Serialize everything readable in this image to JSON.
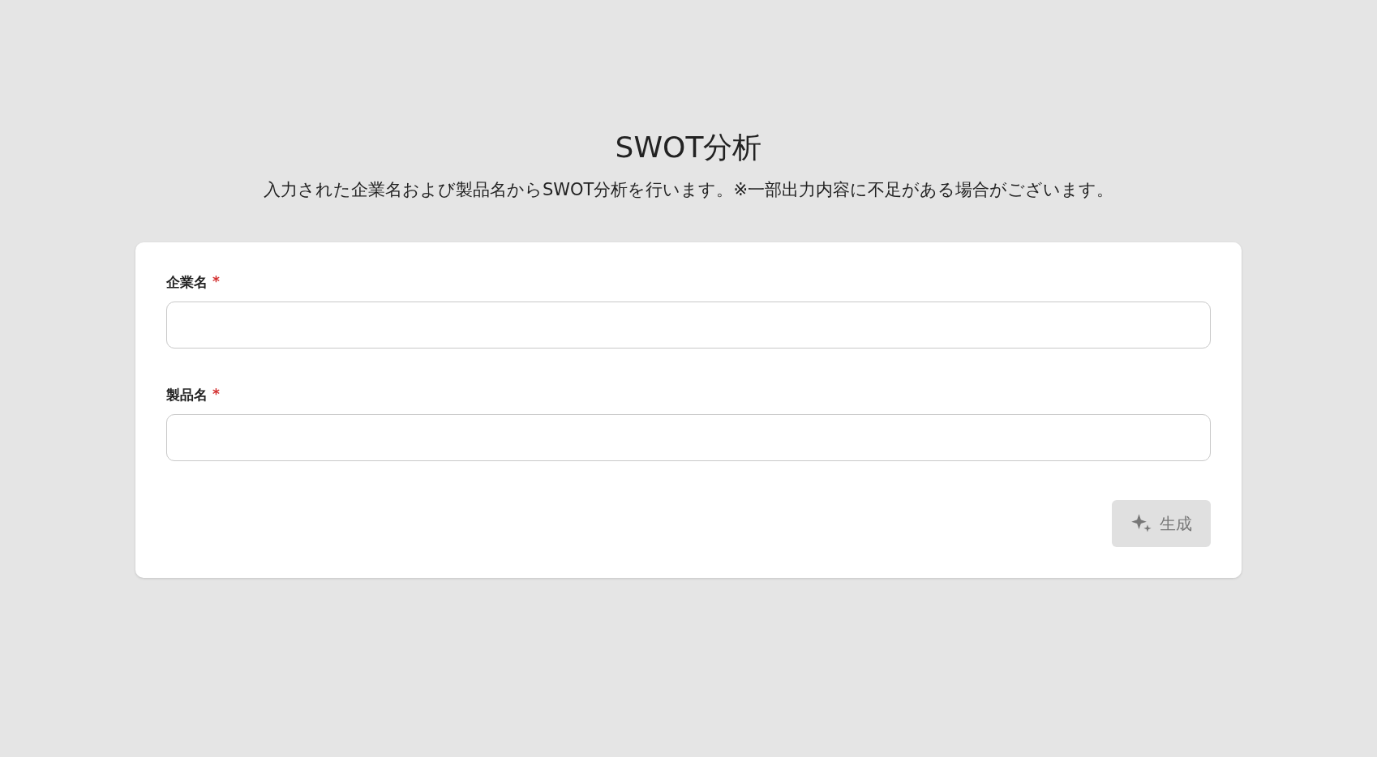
{
  "title": "SWOT分析",
  "description": "入力された企業名および製品名からSWOT分析を行います。※一部出力内容に不足がある場合がございます。",
  "fields": [
    {
      "label": "企業名",
      "required": true,
      "required_mark": "*"
    },
    {
      "label": "製品名",
      "required": true,
      "required_mark": "*"
    }
  ],
  "generate_button": {
    "label": "生成",
    "disabled": true
  }
}
